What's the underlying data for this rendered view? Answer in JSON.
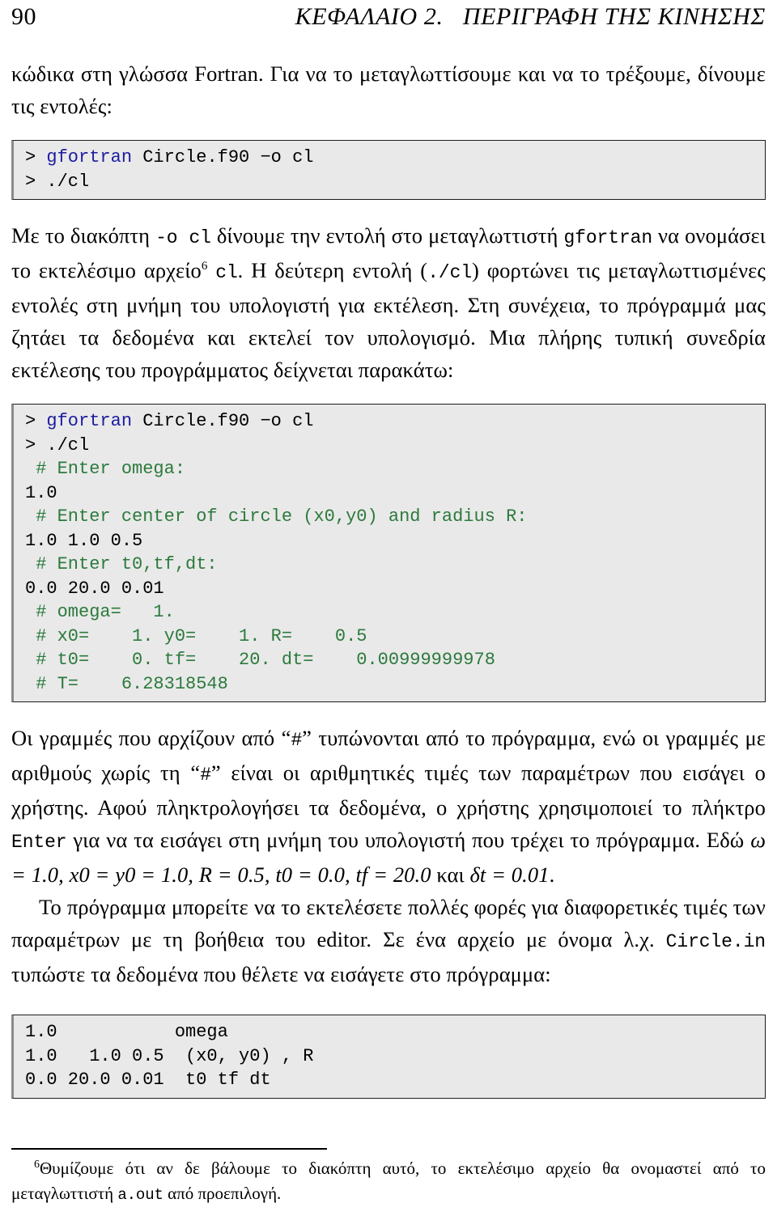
{
  "header": {
    "page_number": "90",
    "chapter_title": "ΚΕΦΑΛΑΙΟ 2.   ΠΕΡΙΓΡΑΦΗ ΤΗΣ ΚΙΝΗΣΗΣ"
  },
  "paragraphs": {
    "p1_part1": "κώδικα στη γλώσσα Fortran. Για να το μεταγλωττίσουμε και να το τρέξουμε, δίνουμε τις εντολές:",
    "p2_a": "Με το διακόπτη ",
    "p2_code1": "-o cl",
    "p2_b": " δίνουμε την εντολή στο μεταγλωττιστή ",
    "p2_code2": "gfortran",
    "p2_c": " να ονομάσει το εκτελέσιμο αρχείο",
    "p2_footnote_mark": "6",
    "p2_code3": "cl",
    "p2_d": ". Η δεύτερη εντολή (",
    "p2_code4": "./cl",
    "p2_e": ") φορτώνει τις μεταγλωττισμένες εντολές στη μνήμη του υπολογιστή για εκτέλεση. Στη συνέχεια, το πρόγραμμά μας ζητάει τα δεδομένα και εκτελεί τον υπολογισμό. Μια πλήρης τυπική συνεδρία εκτέλεσης του προγράμματος δείχνεται παρακάτω:",
    "p3_a": "Οι γραμμές που αρχίζουν από “",
    "p3_hash1": "#",
    "p3_b": "” τυπώνονται από το πρόγραμμα, ενώ οι γραμμές με αριθμούς χωρίς τη “",
    "p3_hash2": "#",
    "p3_c": "” είναι οι αριθμητικές τιμές των παραμέτρων που εισάγει ο χρήστης. Αφού πληκτρολογήσει τα δεδομένα, ο χρήστης χρησιμοποιεί το πλήκτρο ",
    "p3_enter": "Enter",
    "p3_d": " για να τα εισάγει στη μνήμη του υπολογιστή που τρέχει το πρόγραμμα. Εδώ ",
    "p3_math": "ω = 1.0, x0 = y0 = 1.0, R = 0.5, t0 = 0.0, tf = 20.0",
    "p3_e": " και ",
    "p3_math2": "δt = 0.01",
    "p3_f": ".",
    "p4_a": "Το πρόγραμμα μπορείτε να το εκτελέσετε πολλές φορές για διαφορετικές τιμές των παραμέτρων με τη βοήθεια του editor. Σε ένα αρχείο με όνομα λ.χ. ",
    "p4_code": "Circle.in",
    "p4_b": " τυπώστε τα δεδομένα που θέλετε να εισάγετε στο πρόγραμμα:"
  },
  "listing1": {
    "lines": [
      [
        {
          "t": "> ",
          "c": "plain"
        },
        {
          "t": "gfortran",
          "c": "kw"
        },
        {
          "t": " Circle.f90 −o cl",
          "c": "plain"
        }
      ],
      [
        {
          "t": "> ./cl",
          "c": "plain"
        }
      ]
    ]
  },
  "listing2": {
    "lines": [
      [
        {
          "t": "> ",
          "c": "plain"
        },
        {
          "t": "gfortran",
          "c": "kw"
        },
        {
          "t": " Circle.f90 −o cl",
          "c": "plain"
        }
      ],
      [
        {
          "t": "> ./cl",
          "c": "plain"
        }
      ],
      [
        {
          "t": " # Enter omega:",
          "c": "cmt"
        }
      ],
      [
        {
          "t": "1.0",
          "c": "plain"
        }
      ],
      [
        {
          "t": " # Enter center of circle (x0,y0) and radius R:",
          "c": "cmt"
        }
      ],
      [
        {
          "t": "1.0 1.0 0.5",
          "c": "plain"
        }
      ],
      [
        {
          "t": " # Enter t0,tf,dt:",
          "c": "cmt"
        }
      ],
      [
        {
          "t": "0.0 20.0 0.01",
          "c": "plain"
        }
      ],
      [
        {
          "t": " # omega=   1.",
          "c": "cmt"
        }
      ],
      [
        {
          "t": " # x0=    1. y0=    1. R=    0.5",
          "c": "cmt"
        }
      ],
      [
        {
          "t": " # t0=    0. tf=    20. dt=    0.00999999978",
          "c": "cmt"
        }
      ],
      [
        {
          "t": " # T=    6.28318548",
          "c": "cmt"
        }
      ]
    ]
  },
  "listing3": {
    "lines": [
      [
        {
          "t": "1.0           omega",
          "c": "plain"
        }
      ],
      [
        {
          "t": "1.0   1.0 0.5  (x0, y0) , R",
          "c": "plain"
        }
      ],
      [
        {
          "t": "0.0 20.0 0.01  t0 tf dt",
          "c": "plain"
        }
      ]
    ]
  },
  "footnote": {
    "mark": "6",
    "text_a": "Θυμίζουμε ότι αν δε βάλουμε το διακόπτη αυτό, το εκτελέσιμο αρχείο θα ονομαστεί από το μεταγλωττιστή ",
    "code": "a.out",
    "text_b": " από προεπιλογή."
  },
  "colors": {
    "keyword_blue": "#1c1ca0",
    "comment_green": "#2c7a3c",
    "listing_bg": "#e9e9e9",
    "listing_border": "#1c1c1c",
    "text_black": "#000000"
  }
}
